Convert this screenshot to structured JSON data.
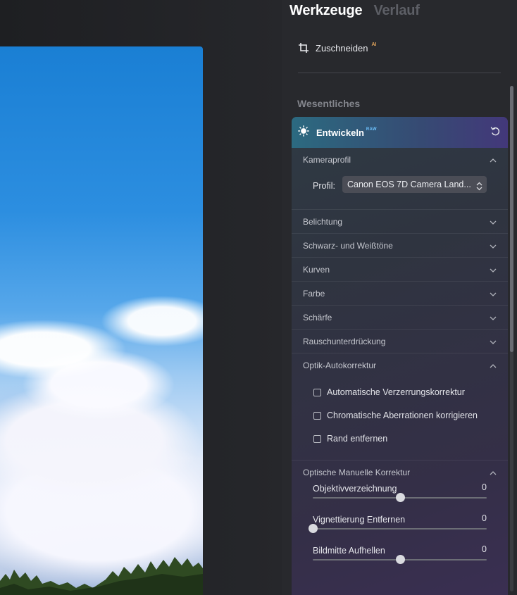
{
  "tabs": [
    {
      "label": "Werkzeuge",
      "active": true
    },
    {
      "label": "Verlauf",
      "active": false
    }
  ],
  "crop": {
    "label": "Zuschneiden",
    "badge": "AI"
  },
  "section_title": "Wesentliches",
  "develop": {
    "title": "Entwickeln",
    "badge": "RAW",
    "camera_profile": {
      "header": "Kameraprofil",
      "profile_label": "Profil:",
      "profile_value": "Canon EOS 7D Camera Land..."
    },
    "collapsed_sections": [
      {
        "label": "Belichtung"
      },
      {
        "label": "Schwarz- und Weißtöne"
      },
      {
        "label": "Kurven"
      },
      {
        "label": "Farbe"
      },
      {
        "label": "Schärfe"
      },
      {
        "label": "Rauschunterdrückung"
      }
    ],
    "optics_auto": {
      "header": "Optik-Autokorrektur",
      "checks": [
        {
          "label": "Automatische Verzerrungskorrektur",
          "checked": false
        },
        {
          "label": "Chromatische Aberrationen korrigieren",
          "checked": false
        },
        {
          "label": "Rand entfernen",
          "checked": false
        }
      ]
    },
    "optics_manual": {
      "header": "Optische Manuelle Korrektur",
      "sliders": [
        {
          "label": "Objektivverzeichnung",
          "value": "0",
          "position": 0.5
        },
        {
          "label": "Vignettierung Entfernen",
          "value": "0",
          "position": 0.0
        },
        {
          "label": "Bildmitte Aufhellen",
          "value": "0",
          "position": 0.5
        }
      ]
    }
  },
  "colors": {
    "accent_raw": "#6ec3ff",
    "accent_ai": "#e0a35a",
    "panel_bg": "#28292d"
  }
}
